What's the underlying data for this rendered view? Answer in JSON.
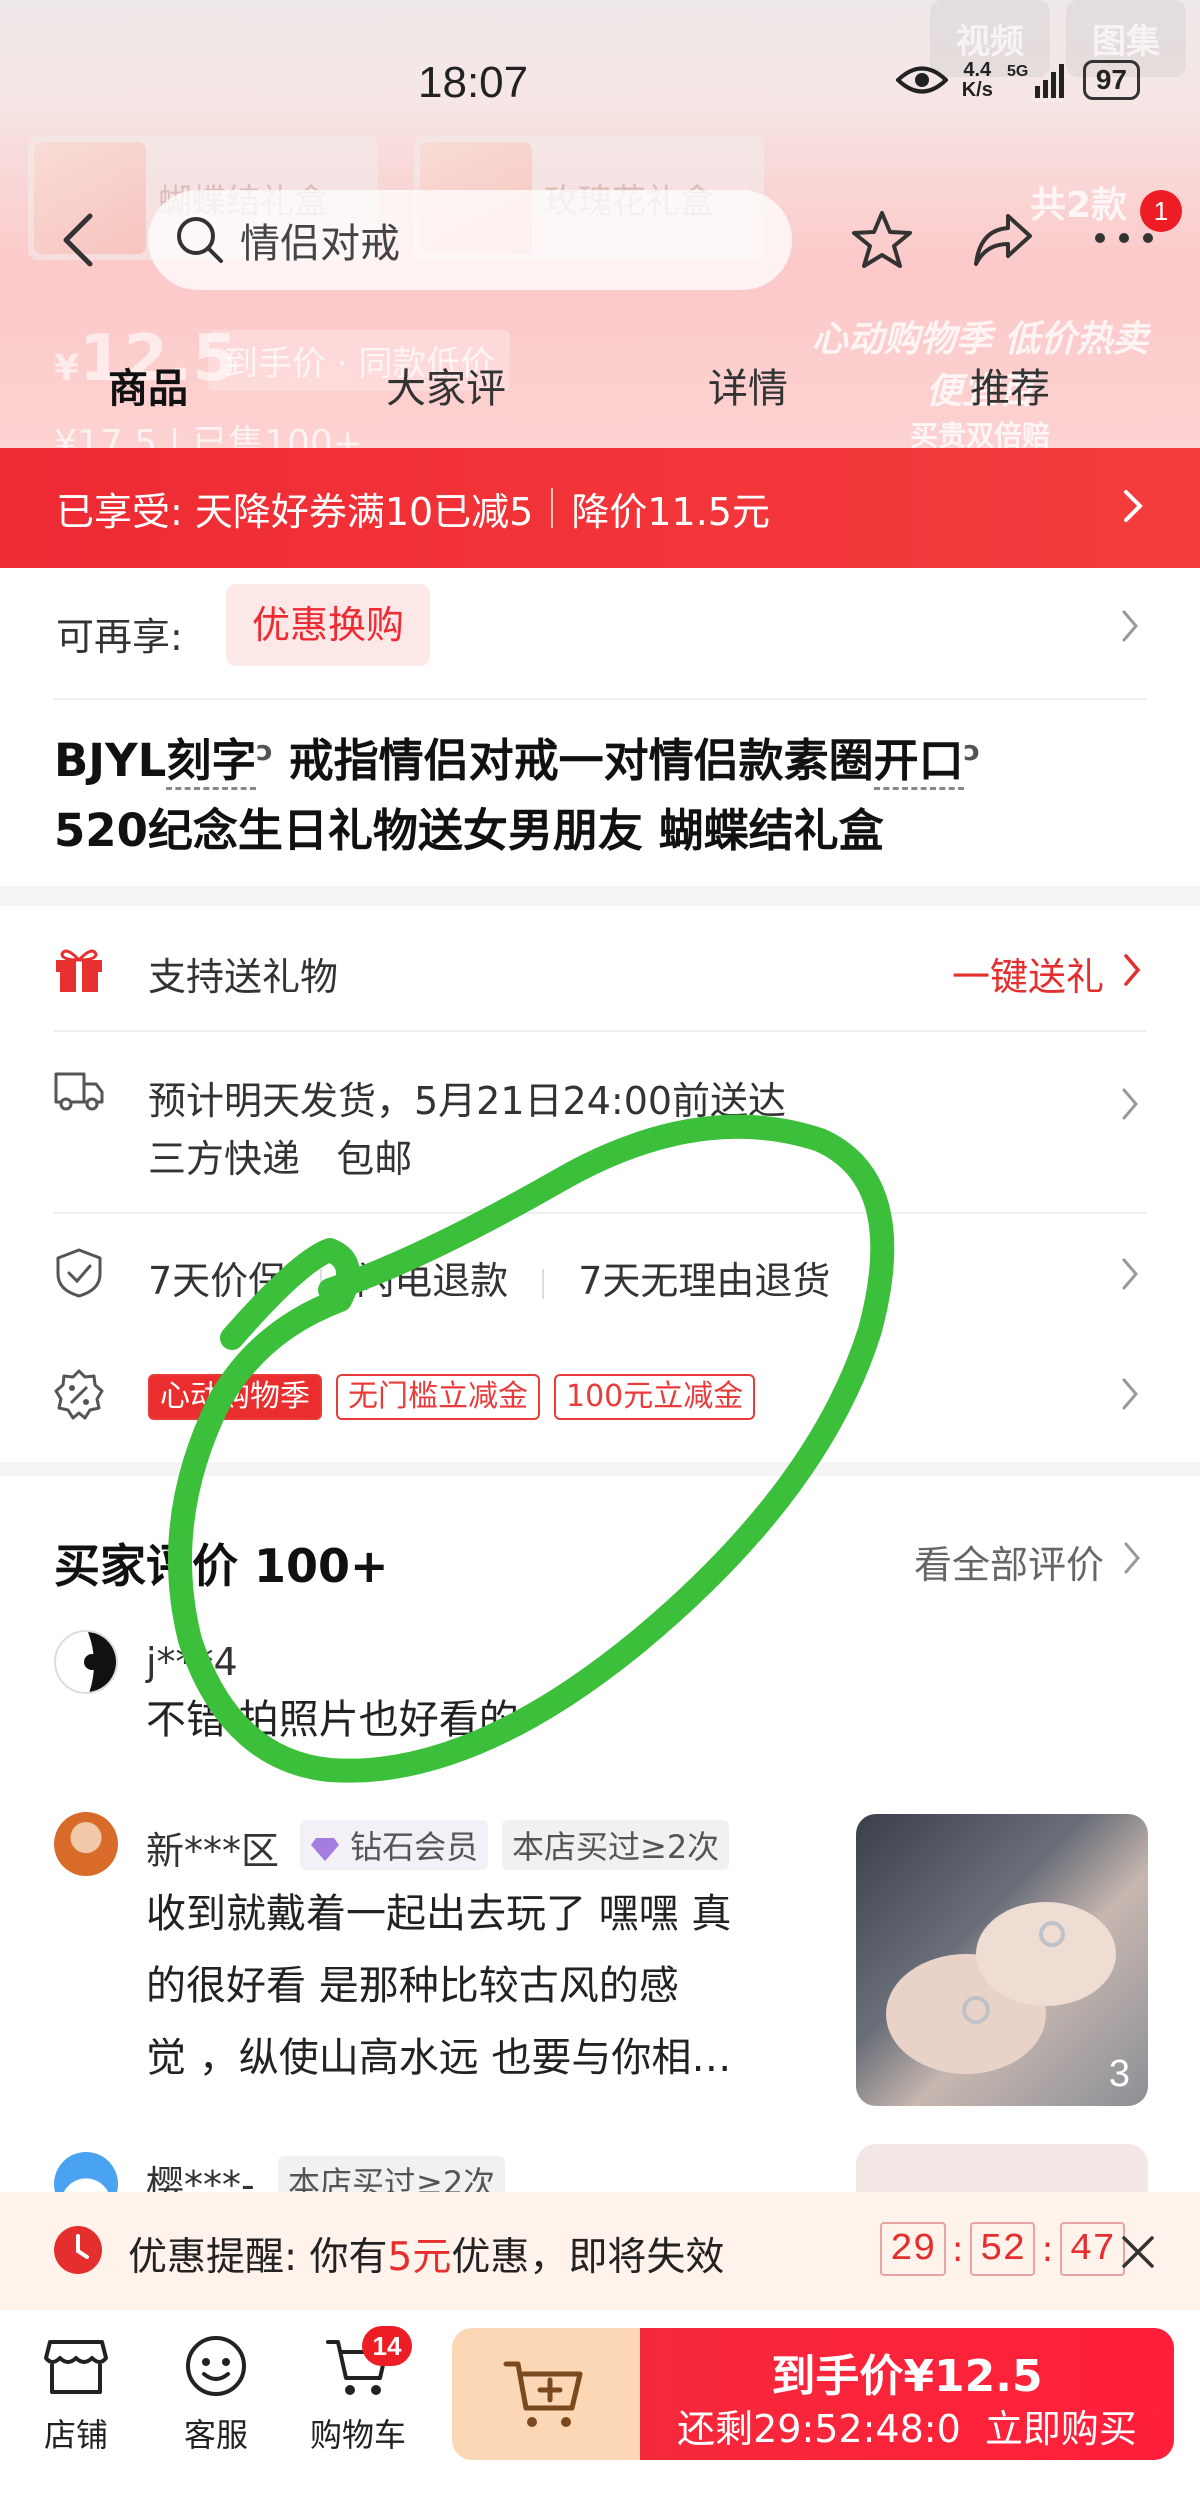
{
  "status_bar": {
    "time": "18:07",
    "net_speed_value": "4.4",
    "net_speed_unit": "K/s",
    "network": "5G",
    "battery": "97"
  },
  "header": {
    "faded_tabs": [
      "视频",
      "图集"
    ],
    "variant_thumbs": [
      "蝴蝶结礼盒",
      "玫瑰花礼盒"
    ],
    "style_count": "共2款",
    "search_text": "情侣对戒",
    "more_badge": "1",
    "ghost_price_symbol": "¥",
    "ghost_price": "12.5",
    "ghost_price_label": "到手价 · 同款低价",
    "ghost_old_price": "¥17.5",
    "ghost_sold": "已售100+",
    "promo_line1": "心动购物季 低价热卖",
    "promo_line2": "便宜百",
    "promo_line3": "买贵双倍赔",
    "tabs": [
      "商品",
      "大家评",
      "详情",
      "推荐"
    ]
  },
  "discount_strip": {
    "prefix": "已享受:",
    "coupon": "天降好券满10已减5",
    "drop": "降价11.5元"
  },
  "product": {
    "more_enjoy_label": "可再享:",
    "exchange_label": "优惠换购",
    "title_line1_a": "BJYL",
    "title_line1_b": "刻字",
    "title_line1_c": "戒指情侣对戒一对情侣款素圈",
    "title_line1_d": "开口",
    "title_line2": "520纪念生日礼物送女男朋友 蝴蝶结礼盒"
  },
  "services": {
    "gift_label": "支持送礼物",
    "gift_link": "一键送礼",
    "shipping_line1": "预计明天发货，5月21日24:00前送达",
    "shipping_line2": "三方快递   包邮",
    "guarantees": [
      "7天价保",
      "闪电退款",
      "7天无理由退货"
    ],
    "promo_tags": [
      "心动购物季",
      "无门槛立减金",
      "100元立减金"
    ]
  },
  "reviews": {
    "title": "买家评价 100+",
    "see_all": "看全部评价",
    "items": [
      {
        "name": "j***4",
        "body": "不错 拍照片也好看的"
      },
      {
        "name": "新***区",
        "member": "钻石会员",
        "buyer": "本店买过≥2次",
        "body_lines": [
          "收到就戴着一起出去玩了 嘿嘿 真",
          "的很好看 是那种比较古风的感",
          "觉 ，纵使山高水远 也要与你相…"
        ],
        "photo_count": "3"
      },
      {
        "name": "樱***-",
        "buyer": "本店买过≥2次"
      }
    ]
  },
  "reminder": {
    "prefix": "优惠提醒: 你有",
    "amount": "5元",
    "suffix": "优惠，即将失效",
    "hh": "29",
    "mm": "52",
    "ss": "47"
  },
  "bottom_bar": {
    "shop": "店铺",
    "service": "客服",
    "cart": "购物车",
    "cart_badge": "14",
    "buy_label": "到手价¥12.5",
    "buy_sub": "还剩29:52:48:0  立即购买"
  },
  "colors": {
    "brand_red": "#ee2a33",
    "annotation_green": "#3cbf3a"
  }
}
